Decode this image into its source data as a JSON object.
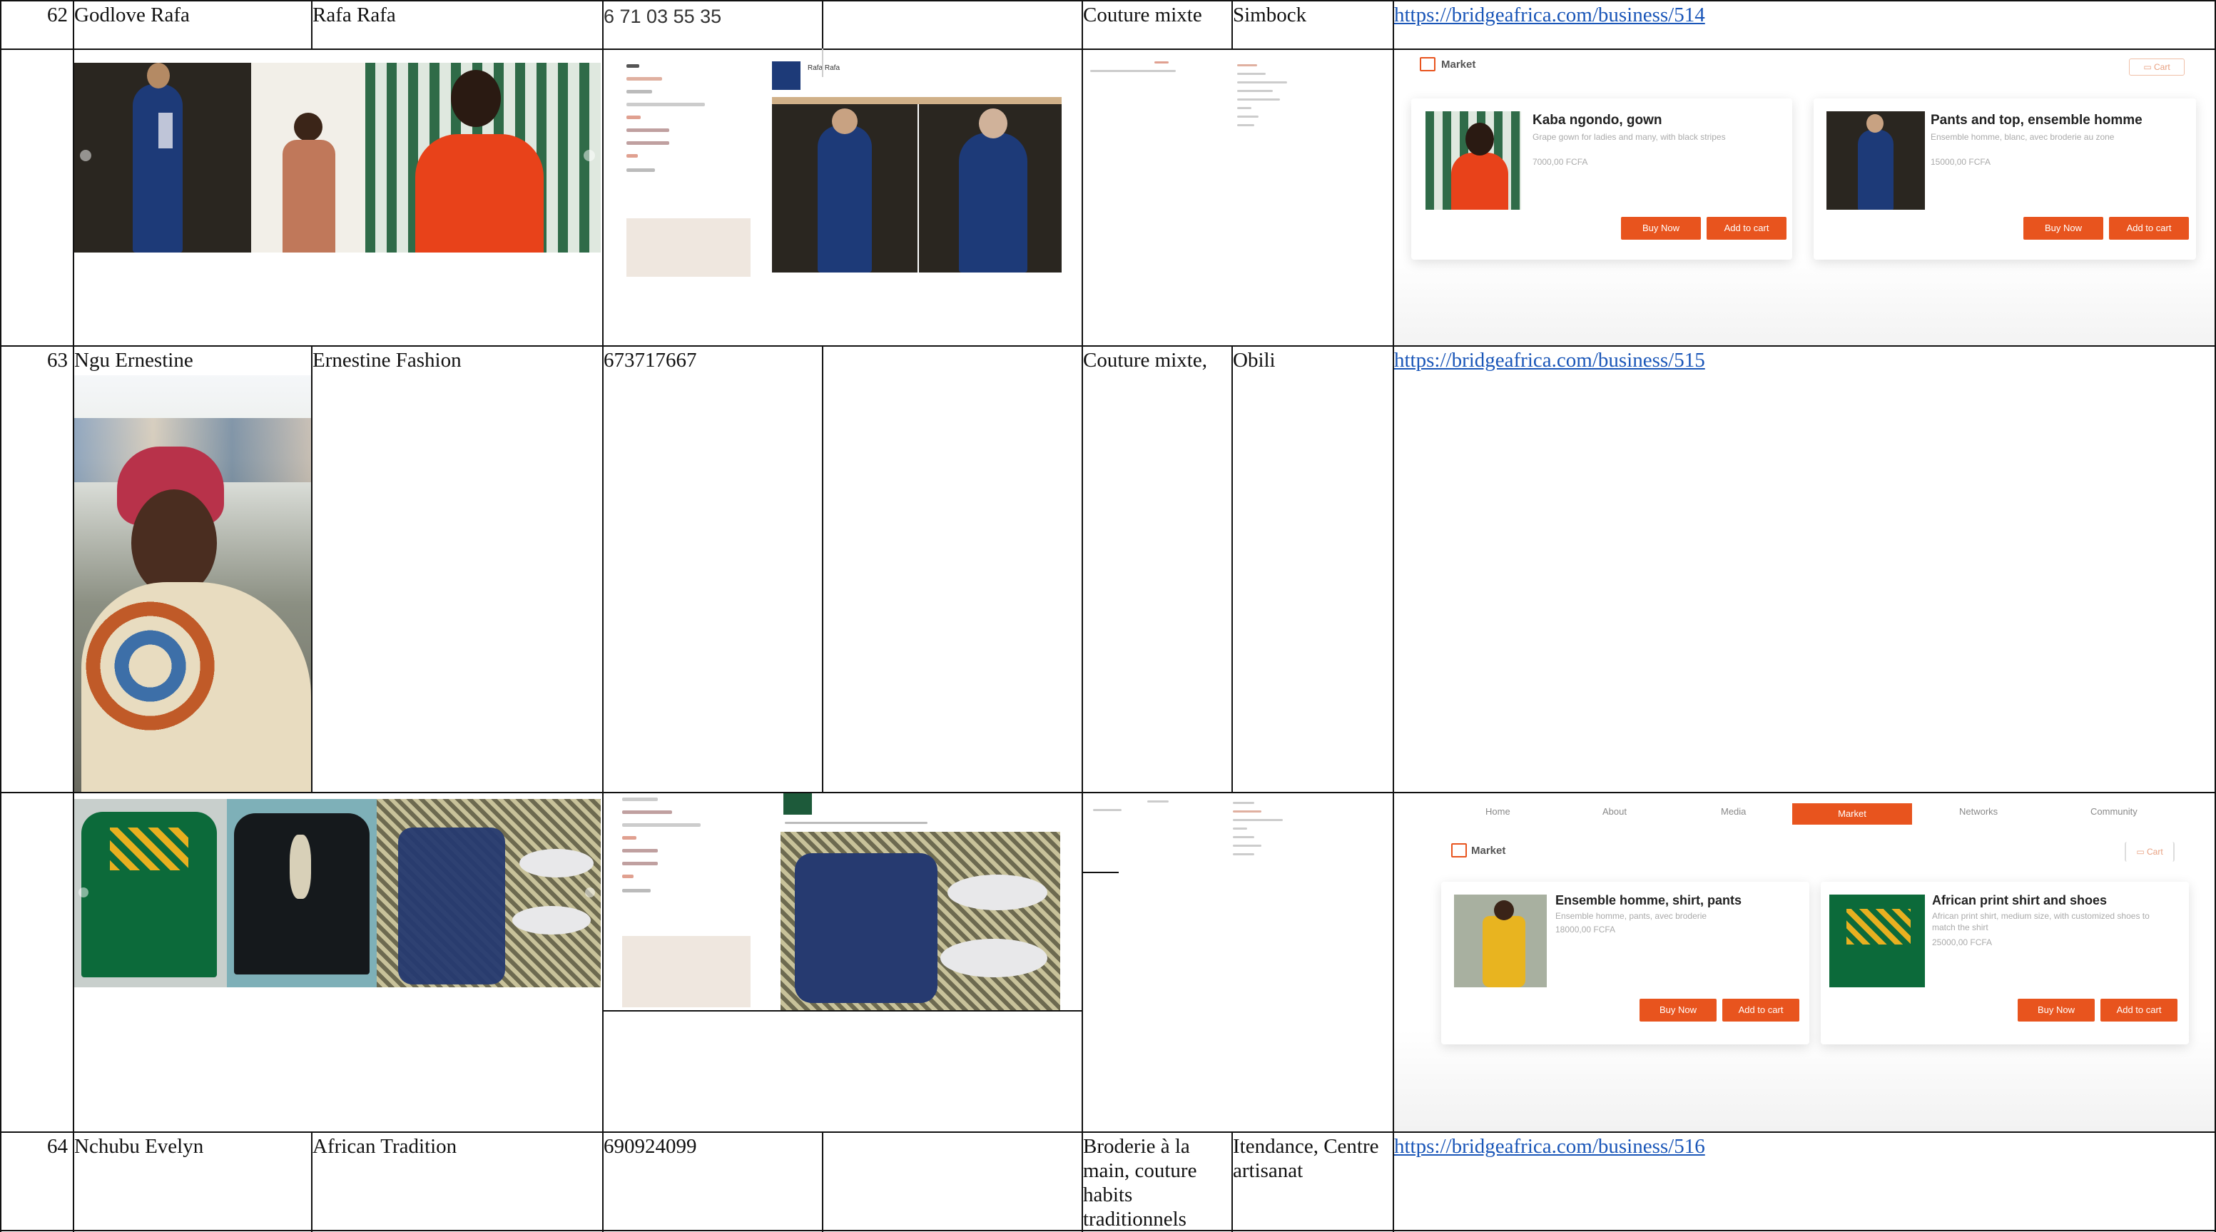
{
  "rows": [
    {
      "num": "62",
      "name": "Godlove Rafa",
      "business": "Rafa Rafa",
      "phone": "6 71 03 55 35",
      "activity": "Couture mixte",
      "location": "Simbock",
      "link": "https://bridgeafrica.com/business/514"
    },
    {
      "num": "63",
      "name": "Ngu Ernestine",
      "business": "Ernestine Fashion",
      "phone": "673717667",
      "activity": "Couture mixte,",
      "location": "Obili",
      "link": "https://bridgeafrica.com/business/515"
    },
    {
      "num": "64",
      "name": "Nchubu Evelyn",
      "business": "African Tradition",
      "phone": "690924099",
      "activity_lines": [
        "Broderie à la",
        "main, couture",
        "habits",
        "traditionnels"
      ],
      "location_lines": [
        "Itendance, Centre",
        "artisanat"
      ],
      "link": "https://bridgeafrica.com/business/516"
    }
  ],
  "market1": {
    "label": "Market",
    "cart": "Cart",
    "products": [
      {
        "title": "Kaba ngondo, gown",
        "desc": "Grape gown for ladies and many, with black stripes",
        "price": "7000,00 FCFA",
        "buy": "Buy Now",
        "add": "Add to cart"
      },
      {
        "title": "Pants and top, ensemble homme",
        "desc": "Ensemble homme, blanc, avec broderie au zone",
        "price": "15000,00 FCFA",
        "buy": "Buy Now",
        "add": "Add to cart"
      }
    ]
  },
  "market2": {
    "label": "Market",
    "cart": "Cart",
    "nav": [
      "Home",
      "About",
      "Media",
      "Market",
      "Networks",
      "Community"
    ],
    "products": [
      {
        "title": "Ensemble homme, shirt, pants",
        "desc": "Ensemble homme, pants, avec broderie",
        "price": "18000,00 FCFA",
        "buy": "Buy Now",
        "add": "Add to cart"
      },
      {
        "title": "African print shirt and shoes",
        "desc": "African print shirt, medium size, with customized shoes to match the shirt",
        "price": "25000,00 FCFA",
        "buy": "Buy Now",
        "add": "Add to cart"
      }
    ]
  },
  "shot1": {
    "business": "Rafa Rafa"
  },
  "colors": {
    "accent": "#e8541e",
    "link": "#1a56b8",
    "navy": "#1d3a78"
  }
}
